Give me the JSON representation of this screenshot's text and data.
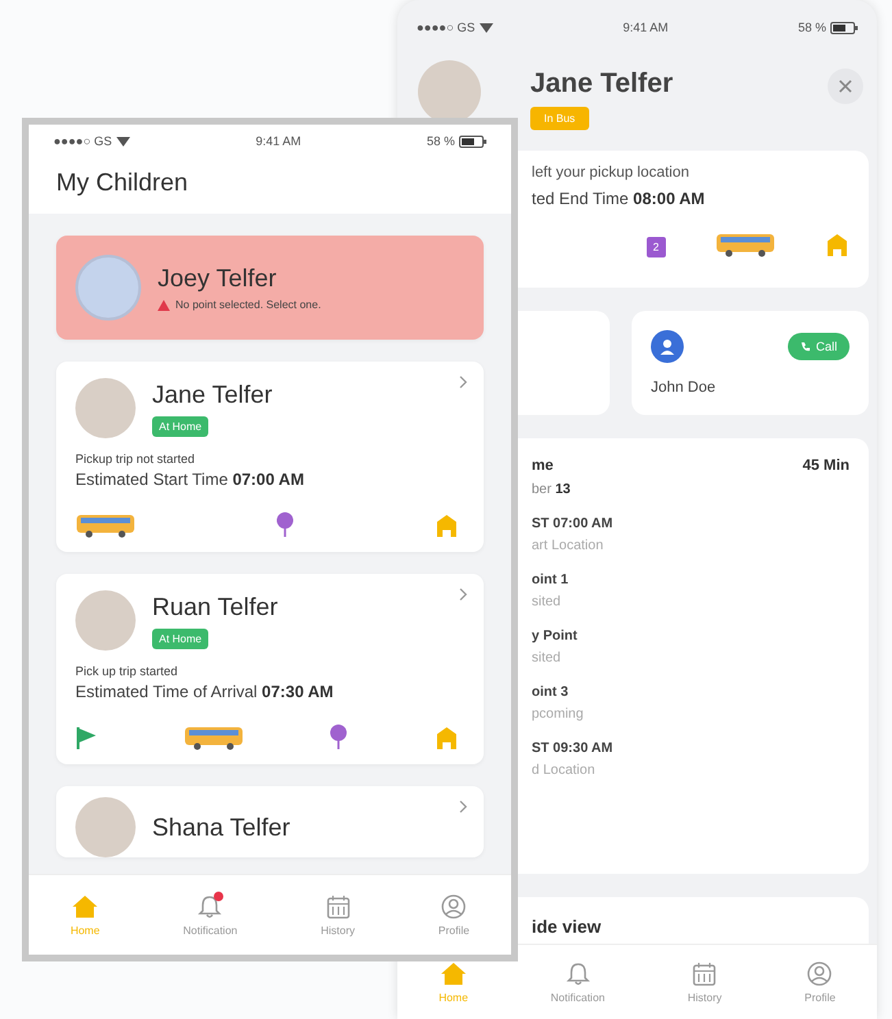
{
  "back_screen": {
    "status_bar": {
      "carrier": "●●●●○ GS",
      "time": "9:41 AM",
      "battery": "58 %"
    },
    "header": {
      "name": "Jane Telfer",
      "badge": {
        "label": "In Bus",
        "color": "#f7b500"
      }
    },
    "trip_card": {
      "status": "left your pickup location",
      "end_time": "ted End Time **08:00 AM**",
      "markers": [
        {
          "kind": "stop",
          "label": "2"
        },
        {
          "kind": "bus"
        },
        {
          "kind": "school"
        }
      ]
    },
    "driver_card": {
      "name": "John Doe",
      "call_label": "Call"
    },
    "timeline": {
      "title": "me",
      "duration": "45 Min",
      "date": "ber **13**",
      "stops": [
        {
          "time": "ST 07:00 AM",
          "label": "art Location"
        },
        {
          "time": "oint 1",
          "label": "sited"
        },
        {
          "time": "y Point",
          "label": "sited"
        },
        {
          "time": "oint 3",
          "label": "pcoming"
        },
        {
          "time": "ST 09:30 AM",
          "label": "d Location"
        }
      ]
    },
    "section_title": "ide view",
    "tab_bar": [
      {
        "label": "Home",
        "kind": "home",
        "selected": true
      },
      {
        "label": "Notification",
        "kind": "bell",
        "selected": false
      },
      {
        "label": "History",
        "kind": "calendar",
        "selected": false
      },
      {
        "label": "Profile",
        "kind": "profile",
        "selected": false
      }
    ]
  },
  "front_screen": {
    "status_bar": {
      "carrier": "●●●●○ GS",
      "time": "9:41 AM",
      "battery": "58 %"
    },
    "title": "My Children",
    "children": [
      {
        "kind": "alert",
        "name": "Joey Telfer",
        "alert": "No point selected. Select one."
      },
      {
        "kind": "normal",
        "name": "Jane Telfer",
        "badge": {
          "label": "At Home",
          "color": "#3cba6c"
        },
        "trip_status": "Pickup trip not started",
        "time_line": "Estimated Start Time **07:00 AM**",
        "markers": [
          {
            "kind": "bus"
          },
          {
            "kind": "pin"
          },
          {
            "kind": "school"
          }
        ]
      },
      {
        "kind": "normal",
        "name": "Ruan Telfer",
        "badge": {
          "label": "At Home",
          "color": "#3cba6c"
        },
        "trip_status": "Pick up trip started",
        "time_line": "Estimated Time of Arrival **07:30 AM**",
        "markers": [
          {
            "kind": "flag"
          },
          {
            "kind": "bus"
          },
          {
            "kind": "pin"
          },
          {
            "kind": "school"
          }
        ]
      },
      {
        "kind": "partial",
        "name": "Shana Telfer"
      }
    ],
    "tab_bar": [
      {
        "label": "Home",
        "kind": "home",
        "selected": true,
        "badge": false
      },
      {
        "label": "Notification",
        "kind": "bell",
        "selected": false,
        "badge": true
      },
      {
        "label": "History",
        "kind": "calendar",
        "selected": false,
        "badge": false
      },
      {
        "label": "Profile",
        "kind": "profile",
        "selected": false,
        "badge": false
      }
    ]
  }
}
